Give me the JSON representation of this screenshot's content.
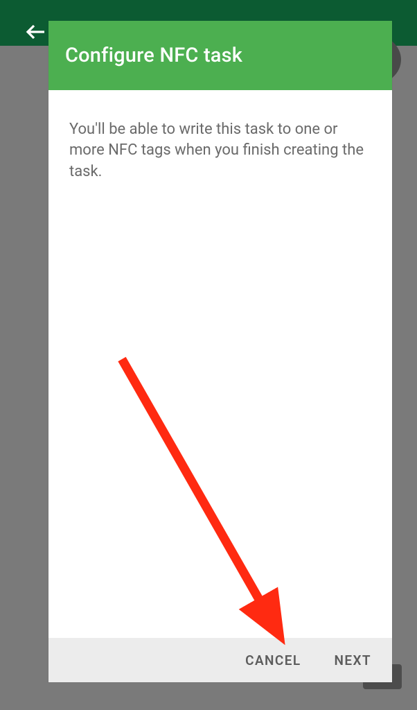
{
  "dialog": {
    "title": "Configure NFC task",
    "body": "You'll be able to write this task to one or more NFC tags when you finish creating the task.",
    "cancel_label": "CANCEL",
    "next_label": "NEXT"
  },
  "colors": {
    "brand_green": "#4CAF50",
    "dark_green": "#0c5b32",
    "arrow": "#FF2A11"
  }
}
